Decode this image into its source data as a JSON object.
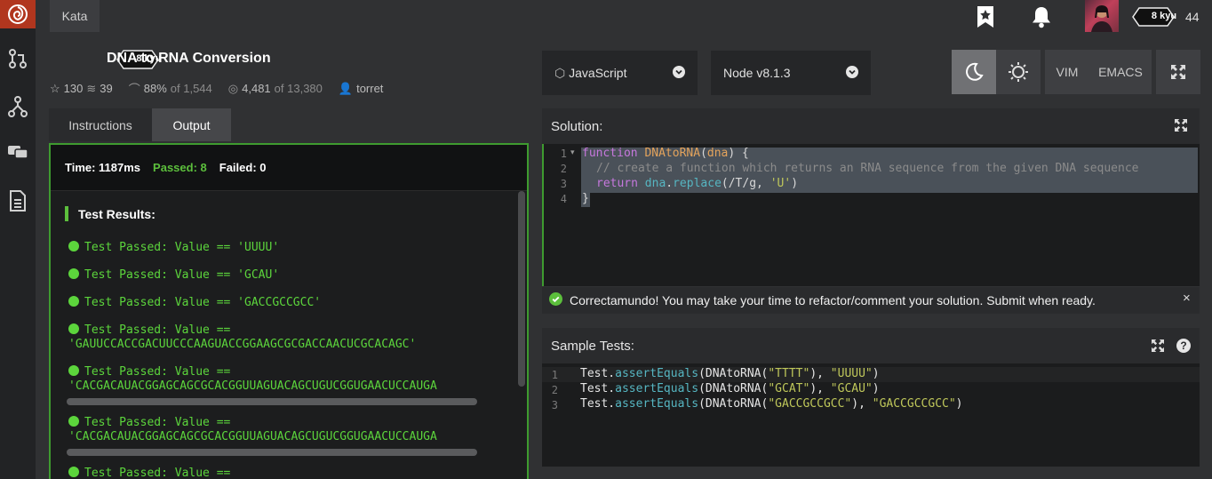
{
  "topbar": {
    "nav_tab": "Kata",
    "user_rank": "8 kyu",
    "honor": "44"
  },
  "kata": {
    "rank": "8 kyu",
    "title": "DNA to RNA Conversion",
    "stars": "130",
    "collections": "39",
    "satisfaction": "88%",
    "satisfaction_of": "of 1,544",
    "completed": "4,481",
    "completed_of": "of 13,380",
    "author": "torret"
  },
  "toolbar": {
    "language": "JavaScript",
    "runtime": "Node v8.1.3",
    "vim_label": "VIM",
    "emacs_label": "EMACS"
  },
  "tabs": {
    "instructions": "Instructions",
    "output": "Output"
  },
  "output": {
    "time": "Time: 1187ms",
    "passed": "Passed: 8",
    "failed": "Failed: 0",
    "results_heading": "Test Results:",
    "results": [
      "Test Passed: Value == 'UUUU'",
      "Test Passed: Value == 'GCAU'",
      "Test Passed: Value == 'GACCGCCGCC'",
      "Test Passed: Value ==",
      "'GAUUCCACCGACUUCCCAAGUACCGGAAGCGCGACCAACUCGCACAGC'",
      "Test Passed: Value ==",
      "'CACGACAUACGGAGCAGCGCACGGUUAGUACAGCUGUCGGUGAACUCCAUGA",
      "Test Passed: Value ==",
      "'CACGACAUACGGAGCAGCGCACGGUUAGUACAGCUGUCGGUGAACUCCAUGA",
      "Test Passed: Value =="
    ]
  },
  "solution": {
    "heading": "Solution:",
    "line_numbers": [
      "1",
      "2",
      "3",
      "4"
    ],
    "code": {
      "kw_function": "function",
      "fn_name": "DNAtoRNA",
      "param": "dna",
      "brace_open": ") {",
      "comment": "// create a function which returns an RNA sequence from the given DNA sequence",
      "kw_return": "return",
      "call_obj": "dna",
      "call_method": "replace",
      "regex": "(/T/g, ",
      "str_u": "'U'",
      "close_paren": ")",
      "brace_close": "}"
    }
  },
  "banner": {
    "message": "Correctamundo! You may take your time to refactor/comment your solution. Submit when ready.",
    "close": "×"
  },
  "sample_tests": {
    "heading": "Sample Tests:",
    "help": "?",
    "line_numbers": [
      "1",
      "2",
      "3"
    ],
    "lines": [
      {
        "obj": "Test.",
        "method": "assertEquals",
        "call": "(DNAtoRNA(",
        "arg": "\"TTTT\"",
        "sep": "), ",
        "exp": "\"UUUU\"",
        "end": ")"
      },
      {
        "obj": "Test.",
        "method": "assertEquals",
        "call": "(DNAtoRNA(",
        "arg": "\"GCAT\"",
        "sep": "), ",
        "exp": "\"GCAU\"",
        "end": ")"
      },
      {
        "obj": "Test.",
        "method": "assertEquals",
        "call": "(DNAtoRNA(",
        "arg": "\"GACCGCCGCC\"",
        "sep": "), ",
        "exp": "\"GACCGCCGCC\"",
        "end": ")"
      }
    ]
  },
  "colors": {
    "accent_green": "#3e9b2f",
    "logo_red": "#b1361e"
  }
}
